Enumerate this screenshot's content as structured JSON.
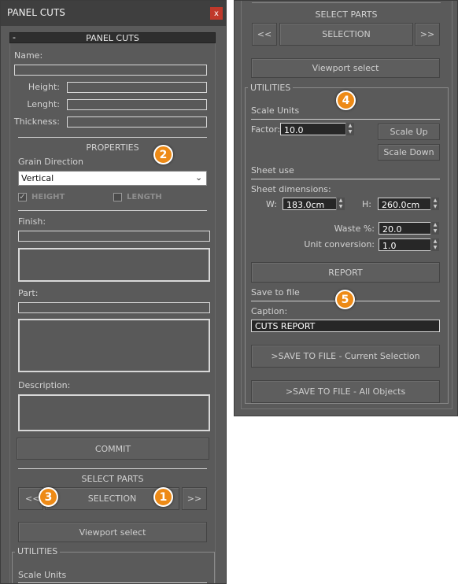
{
  "left": {
    "window_title": "PANEL CUTS",
    "close_glyph": "x",
    "rollout_toggle": "-",
    "rollout_title": "PANEL CUTS",
    "name_label": "Name:",
    "height_label": "Height:",
    "length_label": "Lenght:",
    "thickness_label": "Thickness:",
    "properties_header": "PROPERTIES",
    "grain_label": "Grain Direction",
    "grain_value": "Vertical",
    "height_check_label": "HEIGHT",
    "height_checked": true,
    "length_check_label": "LENGTH",
    "length_checked": false,
    "finish_label": "Finish:",
    "part_label": "Part:",
    "description_label": "Description:",
    "commit_label": "COMMIT",
    "select_parts_header": "SELECT PARTS",
    "prev_label": "<<",
    "selection_label": "SELECTION",
    "next_label": ">>",
    "viewport_select_label": "Viewport select",
    "utilities_title": "UTILITIES",
    "scale_units_label": "Scale Units"
  },
  "right": {
    "select_parts_header": "SELECT PARTS",
    "prev_label": "<<",
    "selection_label": "SELECTION",
    "next_label": ">>",
    "viewport_select_label": "Viewport select",
    "utilities_title": "UTILITIES",
    "scale_units_label": "Scale Units",
    "factor_label": "Factor:",
    "factor_value": "10.0",
    "scale_up_label": "Scale Up",
    "scale_down_label": "Scale Down",
    "sheet_use_label": "Sheet use",
    "sheet_dimensions_label": "Sheet dimensions:",
    "w_label": "W:",
    "w_value": "183.0cm",
    "h_label": "H:",
    "h_value": "260.0cm",
    "waste_label": "Waste %:",
    "waste_value": "20.0",
    "unit_conversion_label": "Unit conversion:",
    "unit_conversion_value": "1.0",
    "report_label": "REPORT",
    "save_to_file_label": "Save to file",
    "caption_label": "Caption:",
    "caption_value": "CUTS REPORT",
    "save_current_label": ">SAVE TO FILE - Current Selection",
    "save_all_label": ">SAVE TO FILE - All Objects"
  },
  "badges": [
    "1",
    "2",
    "3",
    "4",
    "5"
  ],
  "colors": {
    "panel_bg": "#5a5a5a",
    "titlebar_bg": "#3f3f3f",
    "close_button": "#c0392b",
    "badge_orange": "#ed8a16",
    "input_dark": "#272727"
  }
}
